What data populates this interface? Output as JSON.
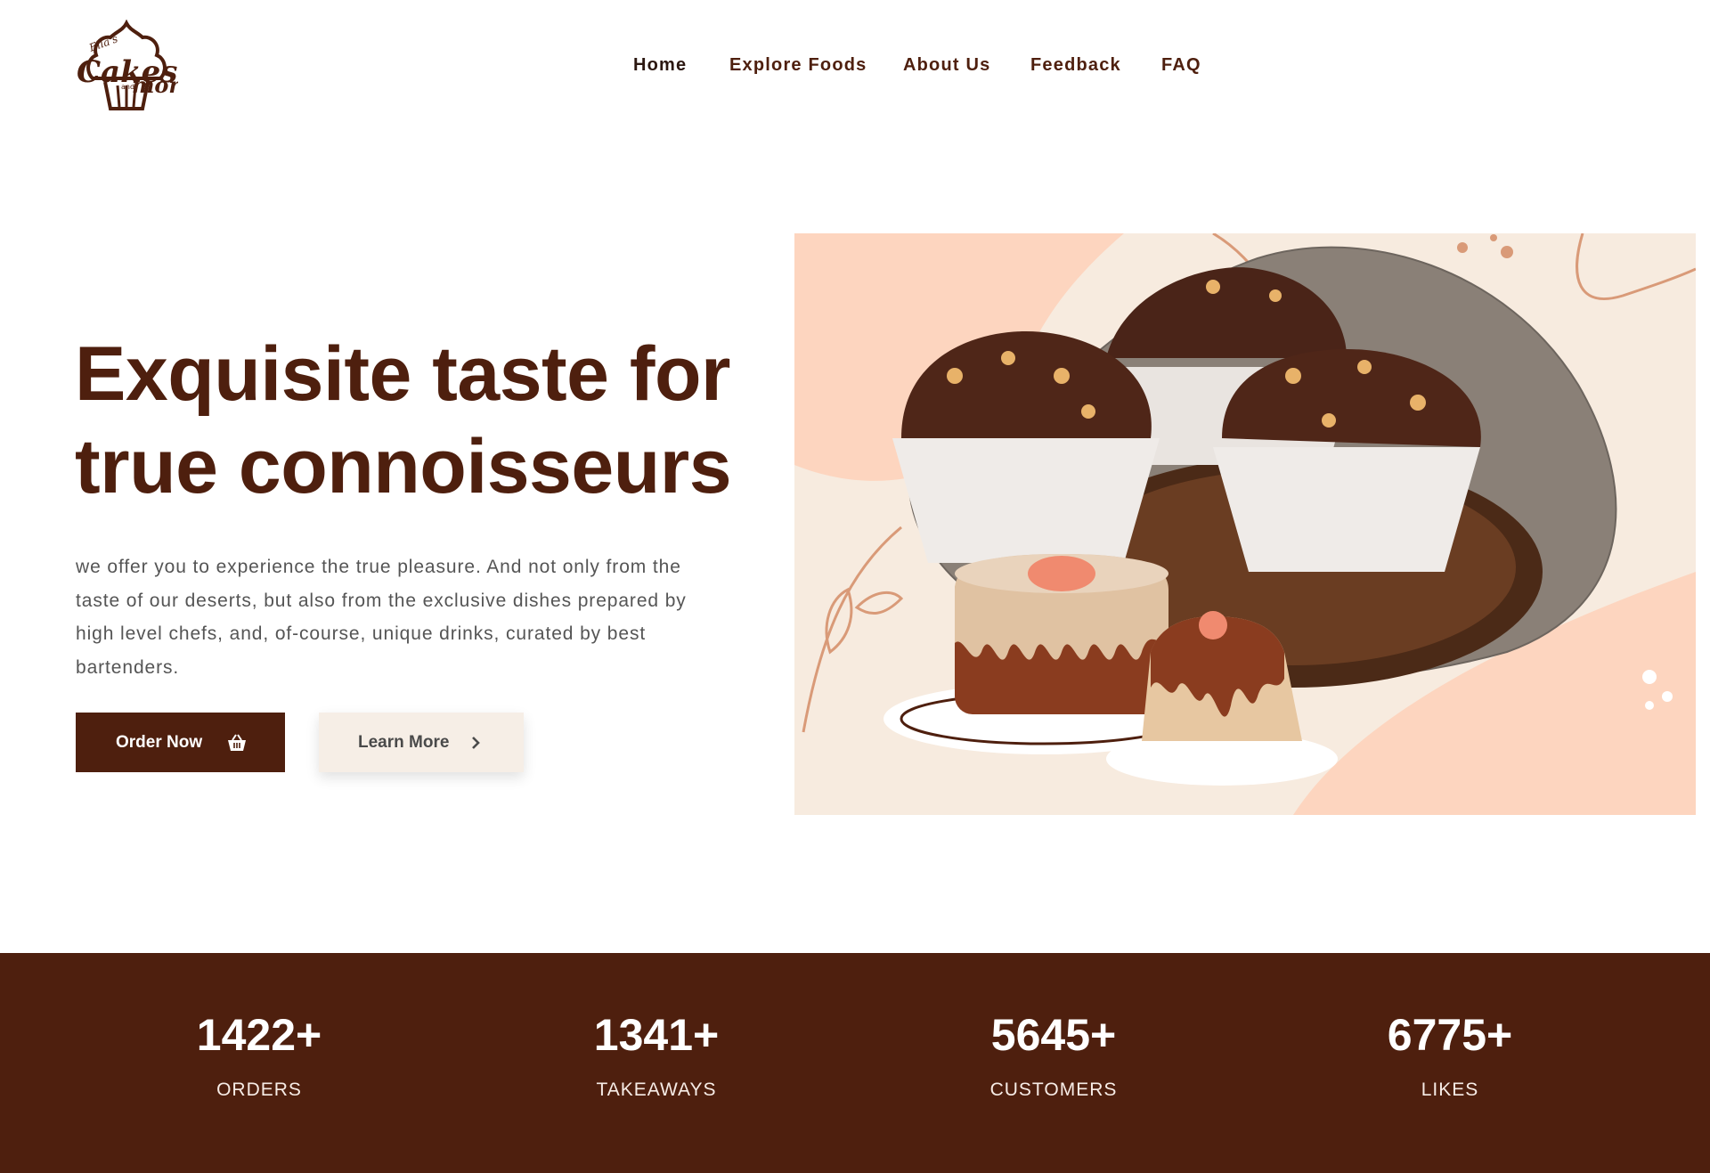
{
  "brand": {
    "logo_name": "Ella's Cakes and more",
    "logo_text_top": "Ella's",
    "logo_text_main": "Cakes",
    "logo_text_and": "and",
    "logo_text_more": "more"
  },
  "nav": {
    "items": [
      {
        "label": "Home"
      },
      {
        "label": "Explore Foods"
      },
      {
        "label": "About Us"
      },
      {
        "label": "Feedback"
      },
      {
        "label": "FAQ"
      }
    ]
  },
  "hero": {
    "title_line1": "Exquisite taste for",
    "title_line2": "true connoisseurs",
    "description": "we offer you to experience the true pleasure. And not only from the taste of our deserts, but also from the exclusive dishes prepared by high level chefs, and, of-course, unique drinks, curated by best bartenders.",
    "order_button": "Order Now",
    "order_icon": "basket-icon",
    "learn_button": "Learn More",
    "learn_icon": "chevron-right-icon",
    "image_description_icon": "hero-illustration"
  },
  "stats": [
    {
      "value": "1422+",
      "label": "ORDERS"
    },
    {
      "value": "1341+",
      "label": "TAKEAWAYS"
    },
    {
      "value": "5645+",
      "label": "CUSTOMERS"
    },
    {
      "value": "6775+",
      "label": "LIKES"
    }
  ],
  "colors": {
    "brand_brown": "#4e1f0e",
    "learn_bg": "#f6eee6",
    "peach": "#fdd5bf",
    "cream": "#f7ebdf"
  }
}
